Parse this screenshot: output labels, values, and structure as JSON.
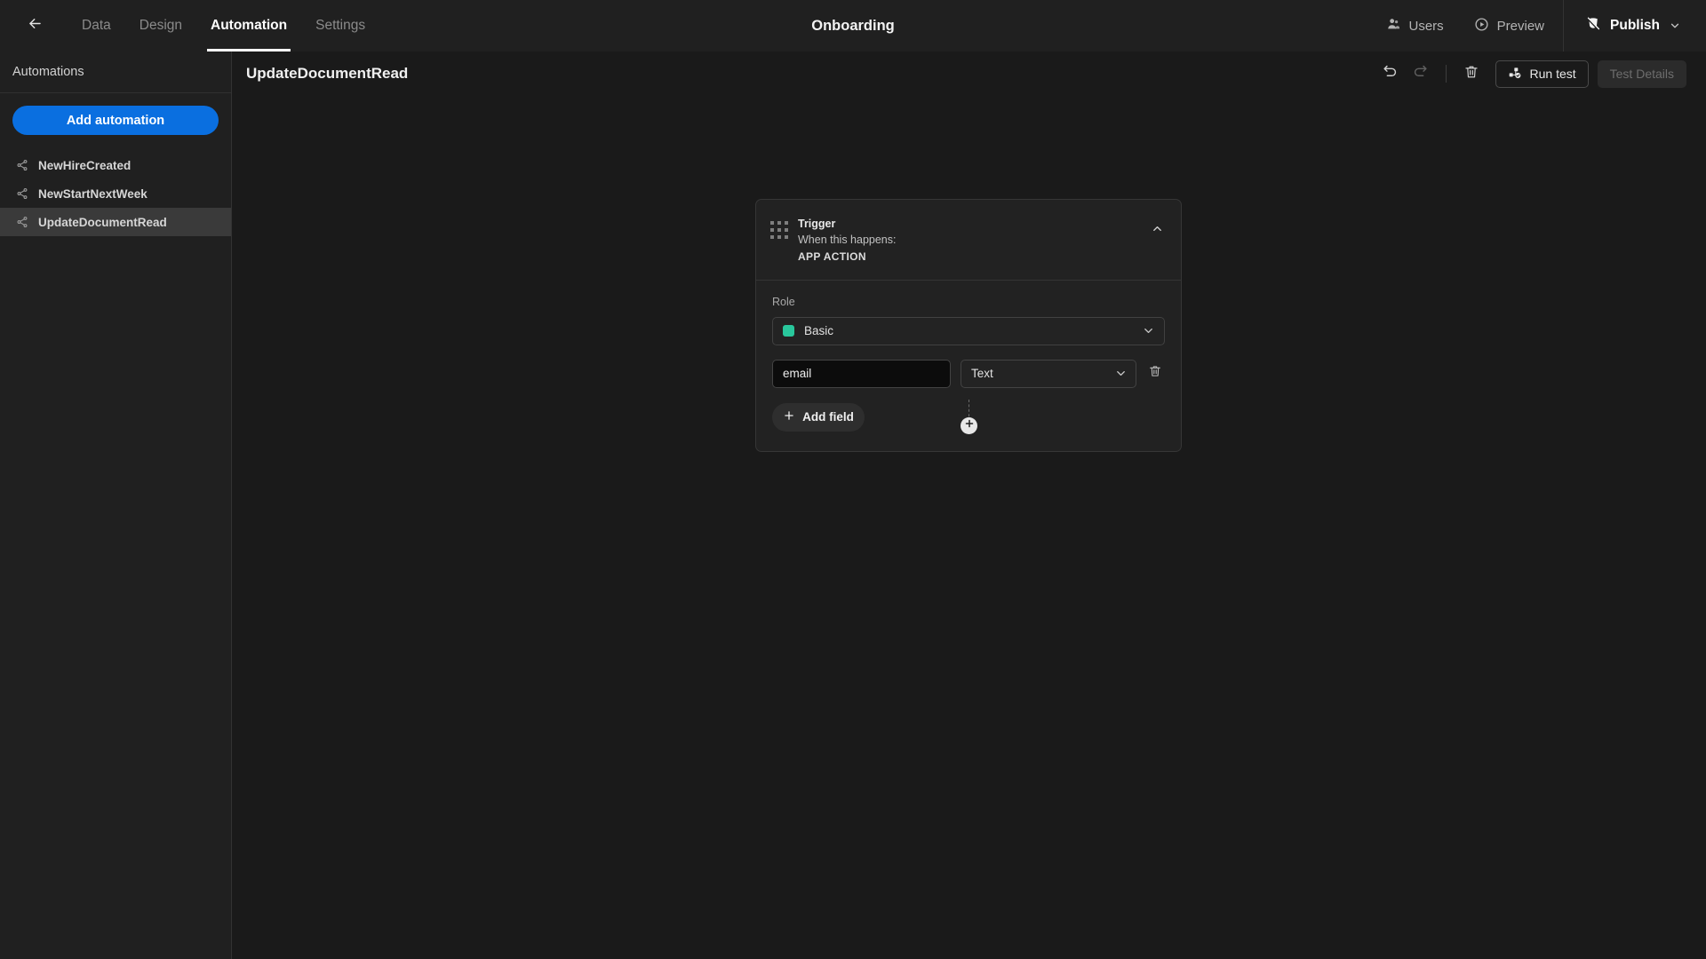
{
  "topbar": {
    "back_icon": "arrow-left-icon",
    "tabs": [
      {
        "label": "Data",
        "active": false
      },
      {
        "label": "Design",
        "active": false
      },
      {
        "label": "Automation",
        "active": true
      },
      {
        "label": "Settings",
        "active": false
      }
    ],
    "title": "Onboarding",
    "users_label": "Users",
    "users_icon": "users-icon",
    "preview_label": "Preview",
    "preview_icon": "play-circle-icon",
    "publish_label": "Publish",
    "publish_icon": "publish-globe-icon",
    "publish_chevron_icon": "chevron-down-icon"
  },
  "sidebar": {
    "heading": "Automations",
    "add_button_label": "Add automation",
    "items": [
      {
        "label": "NewHireCreated",
        "icon": "share-nodes-icon",
        "selected": false
      },
      {
        "label": "NewStartNextWeek",
        "icon": "share-nodes-icon",
        "selected": false
      },
      {
        "label": "UpdateDocumentRead",
        "icon": "share-nodes-icon",
        "selected": true
      }
    ]
  },
  "content": {
    "title": "UpdateDocumentRead",
    "toolbar": {
      "undo_icon": "undo-icon",
      "redo_icon": "redo-icon",
      "delete_icon": "trash-icon",
      "run_test_label": "Run test",
      "run_test_icon": "run-test-icon",
      "test_details_label": "Test Details"
    }
  },
  "flow": {
    "trigger_card": {
      "drag_handle_icon": "drag-grid-icon",
      "title": "Trigger",
      "subtitle": "When this happens:",
      "type_label": "APP ACTION",
      "collapse_icon": "chevron-up-icon",
      "role_label": "Role",
      "role_value": "Basic",
      "role_swatch_color": "#29c79c",
      "role_chevron_icon": "chevron-down-icon",
      "fields": [
        {
          "name_value": "email",
          "name_placeholder": "Field name",
          "type_value": "Text",
          "type_chevron_icon": "chevron-down-icon",
          "delete_icon": "trash-icon"
        }
      ],
      "add_field_label": "Add field",
      "add_field_icon": "plus-icon"
    },
    "add_step_icon": "plus-circle-icon"
  }
}
